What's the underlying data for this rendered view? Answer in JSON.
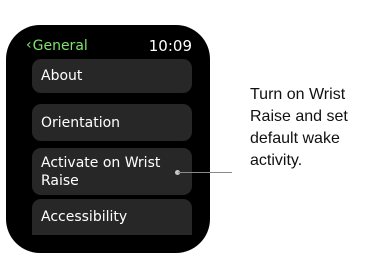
{
  "status_bar": {
    "back_label": "General",
    "back_icon": "chevron-left-icon",
    "time": "10:09"
  },
  "menu": {
    "items": [
      {
        "label": "About"
      },
      {
        "label": "Orientation"
      },
      {
        "label": "Activate on Wrist\nRaise"
      },
      {
        "label": "Accessibility"
      }
    ]
  },
  "callout": {
    "text": "Turn on Wrist\nRaise and set\ndefault wake\nactivity."
  },
  "colors": {
    "accent": "#7de36b",
    "watch_bg": "#000000",
    "item_bg": "#272727",
    "text_primary": "#ffffff"
  }
}
